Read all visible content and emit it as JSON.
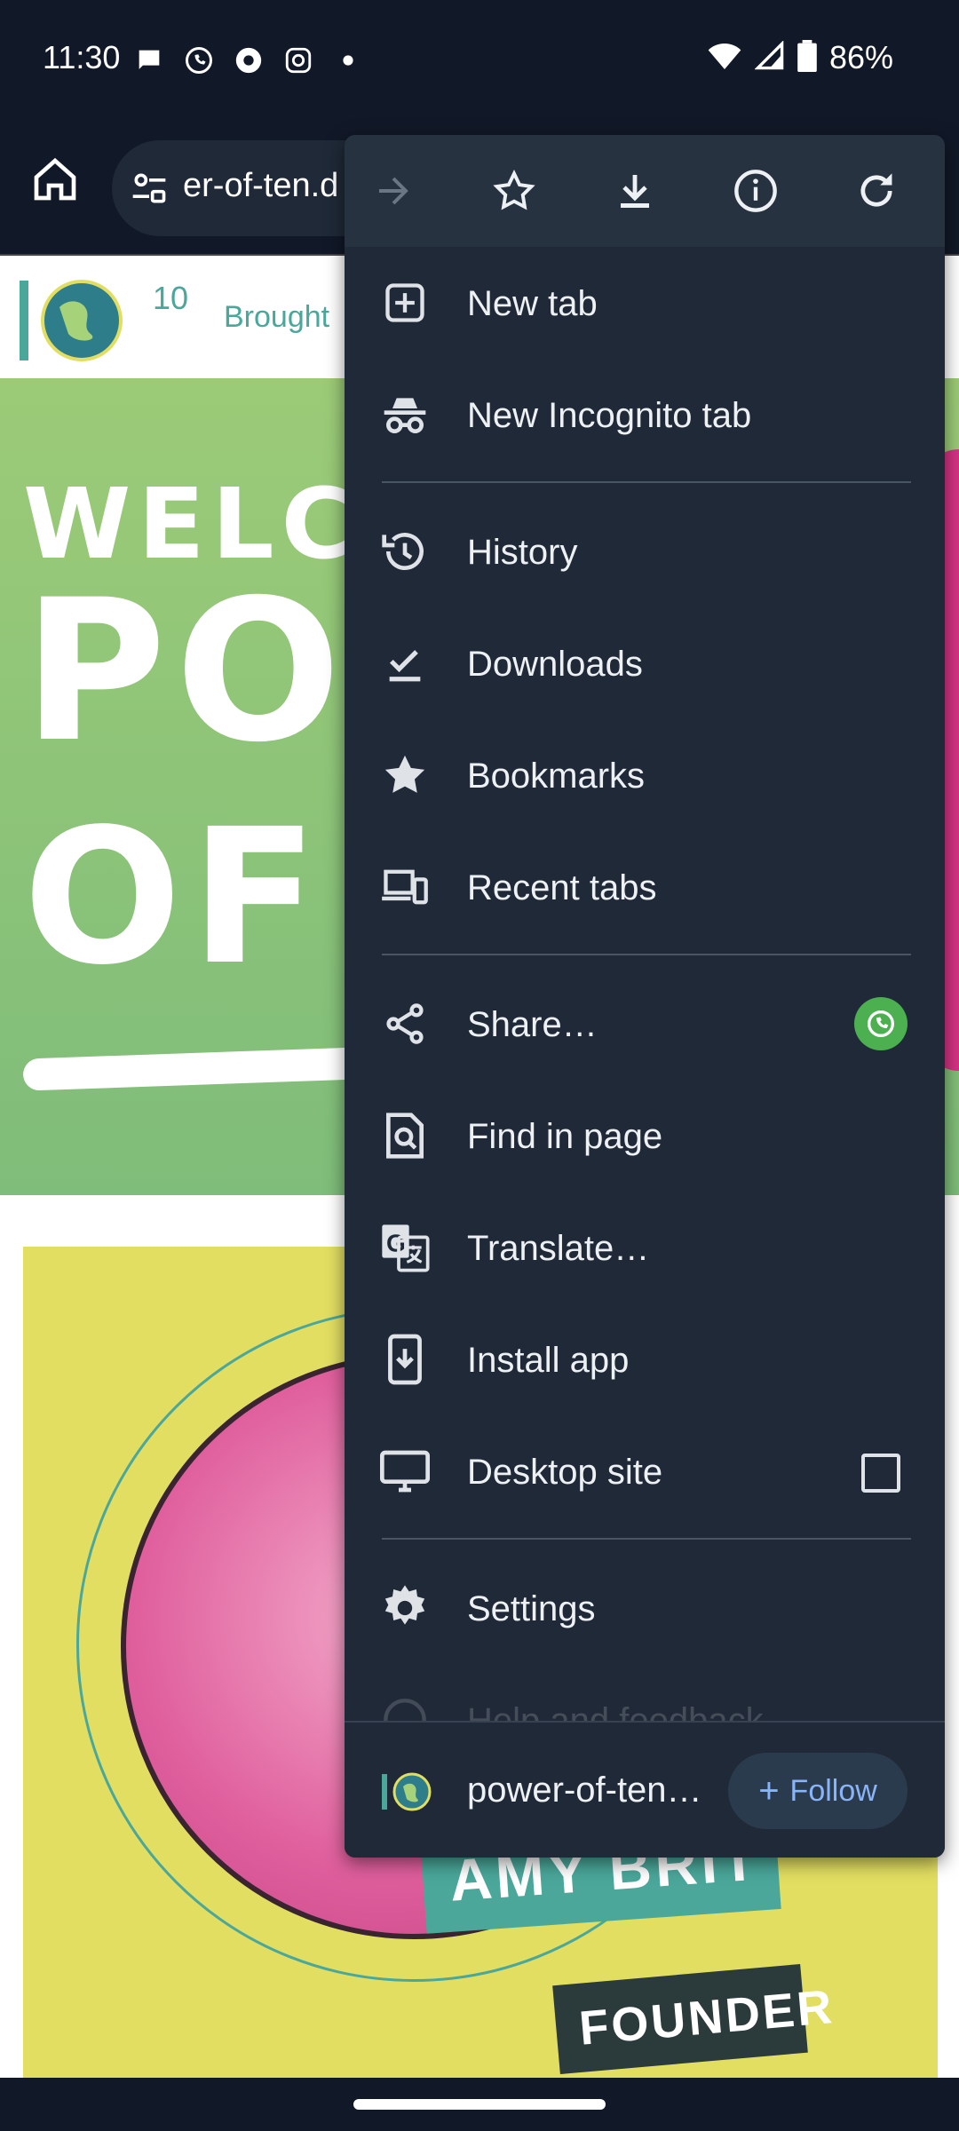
{
  "status_bar": {
    "time": "11:30",
    "battery": "86%",
    "notification_icons": [
      "chat-bubble-icon",
      "whatsapp-icon",
      "chrome-icon",
      "instagram-icon",
      "dot-icon"
    ]
  },
  "toolbar": {
    "url": "er-of-ten.d"
  },
  "page": {
    "brought_text": "Brought",
    "hero_welcome": "WELCON",
    "hero_pow": "POW",
    "hero_of": "OF",
    "name_banner": "AMY BRIT",
    "founder": "FOUNDER",
    "colors": {
      "hero_green": "#7fbd7a",
      "yellow": "#e2de62",
      "pink": "#d63384",
      "teal": "#4aa79a"
    }
  },
  "menu": {
    "top_icons": [
      "forward-arrow-icon",
      "bookmark-star-icon",
      "download-icon",
      "info-icon",
      "refresh-icon"
    ],
    "items": [
      {
        "label": "New tab",
        "icon": "new-tab-icon"
      },
      {
        "label": "New Incognito tab",
        "icon": "incognito-icon"
      },
      {
        "label": "History",
        "icon": "history-icon"
      },
      {
        "label": "Downloads",
        "icon": "downloads-icon"
      },
      {
        "label": "Bookmarks",
        "icon": "bookmarks-icon"
      },
      {
        "label": "Recent tabs",
        "icon": "recent-tabs-icon"
      },
      {
        "label": "Share…",
        "icon": "share-icon"
      },
      {
        "label": "Find in page",
        "icon": "find-in-page-icon"
      },
      {
        "label": "Translate…",
        "icon": "translate-icon"
      },
      {
        "label": "Install app",
        "icon": "install-app-icon"
      },
      {
        "label": "Desktop site",
        "icon": "desktop-icon"
      },
      {
        "label": "Settings",
        "icon": "settings-icon"
      },
      {
        "label": "Help and feedback",
        "icon": "help-icon"
      }
    ],
    "footer": {
      "site": "power-of-ten…",
      "follow_label": "Follow"
    },
    "desktop_site_checked": false
  }
}
